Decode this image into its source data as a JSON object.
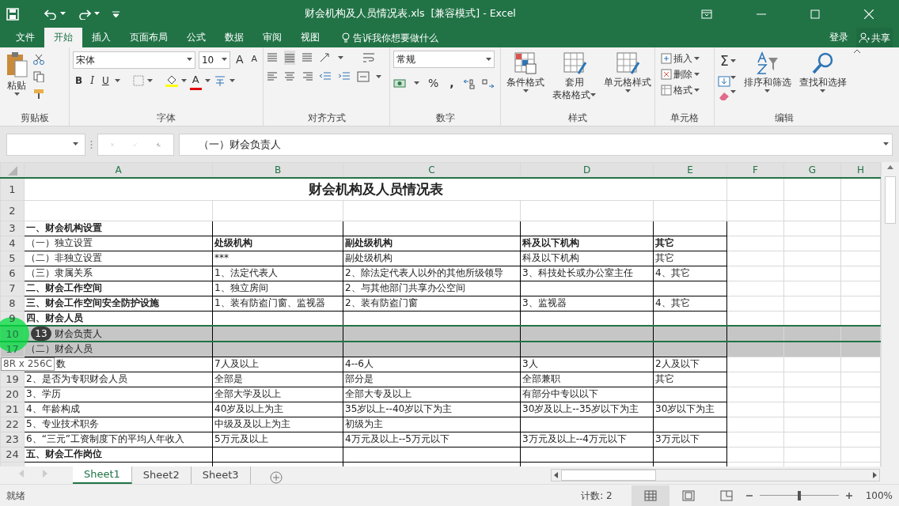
{
  "title_bar": {
    "title": "财会机构及人员情况表.xls  [兼容模式] - Excel"
  },
  "ribbon_tabs": [
    {
      "label": "文件",
      "selected": false
    },
    {
      "label": "开始",
      "selected": true
    },
    {
      "label": "插入",
      "selected": false
    },
    {
      "label": "页面布局",
      "selected": false
    },
    {
      "label": "公式",
      "selected": false
    },
    {
      "label": "数据",
      "selected": false
    },
    {
      "label": "审阅",
      "selected": false
    },
    {
      "label": "视图",
      "selected": false
    }
  ],
  "tell_me": "告诉我你想要做什么",
  "account": {
    "sign_in": "登录",
    "share": "共享"
  },
  "ribbon": {
    "clipboard": {
      "paste": "粘贴",
      "label": "剪贴板"
    },
    "font": {
      "name": "宋体",
      "size": "10",
      "grow": "A",
      "shrink": "A",
      "bold": "B",
      "italic": "I",
      "underline": "U",
      "font_color": "A",
      "label": "字体"
    },
    "alignment": {
      "label": "对齐方式"
    },
    "number": {
      "format": "常规",
      "percent": "%",
      "comma": ",",
      "label": "数字"
    },
    "styles": {
      "conditional": "条件格式",
      "table_line1": "套用",
      "table_line2": "表格格式",
      "cell_styles": "单元格样式",
      "label": "样式"
    },
    "cells": {
      "insert": "插入",
      "delete": "删除",
      "format": "格式",
      "label": "单元格"
    },
    "editing": {
      "sum": "Σ",
      "sort": "排序和筛选",
      "find": "查找和选择",
      "label": "编辑"
    }
  },
  "formula_bar": {
    "content": "（一）财会负责人"
  },
  "columns": [
    {
      "label": "A",
      "selected": true
    },
    {
      "label": "B",
      "selected": true
    },
    {
      "label": "C",
      "selected": true
    },
    {
      "label": "D",
      "selected": true
    },
    {
      "label": "E",
      "selected": true
    },
    {
      "label": "F",
      "selected": true
    },
    {
      "label": "G",
      "selected": true
    },
    {
      "label": "H",
      "selected": true
    }
  ],
  "rows": [
    {
      "number": "1",
      "kind": "title",
      "selected": false,
      "cells": [
        "财会机构及人员情况表"
      ]
    },
    {
      "number": "2",
      "kind": "blank",
      "selected": false
    },
    {
      "number": "3",
      "kind": "section",
      "selected": false,
      "cells": [
        "一、财会机构设置"
      ]
    },
    {
      "number": "4",
      "kind": "header",
      "selected": false,
      "cells": [
        "（一）独立设置",
        "处级机构",
        "副处级机构",
        "科及以下机构",
        "其它"
      ]
    },
    {
      "number": "5",
      "kind": "plain",
      "selected": false,
      "cells": [
        "（二）非独立设置",
        "***",
        "副处级机构",
        "科及以下机构",
        "其它"
      ]
    },
    {
      "number": "6",
      "kind": "plain",
      "selected": false,
      "cells": [
        "（三）隶属关系",
        "1、法定代表人",
        "2、除法定代表人以外的其他所级领导",
        "3、科技处长或办公室主任",
        "4、其它"
      ]
    },
    {
      "number": "7",
      "kind": "section",
      "selected": false,
      "cells": [
        "二、财会工作空间",
        "1、独立房间",
        "2、与其他部门共享办公空间"
      ]
    },
    {
      "number": "8",
      "kind": "section",
      "selected": false,
      "cells": [
        "三、财会工作空间安全防护设施",
        "1、装有防盗门窗、监视器",
        "2、装有防盗门窗",
        "3、监视器",
        "4、其它"
      ]
    },
    {
      "number": "9",
      "kind": "section",
      "selected": false,
      "cells": [
        "四、财会人员"
      ]
    },
    {
      "number": "10",
      "kind": "plain",
      "selected": true,
      "click_marker": "13",
      "cells": [
        "财会负责人"
      ]
    },
    {
      "number": "17",
      "kind": "plain",
      "selected": true,
      "cells": [
        "（二）财会人员"
      ]
    },
    {
      "kind": "plain",
      "selected": false,
      "tooltip": "8R x 256C",
      "cells": [
        "数",
        "7人及以上",
        "4--6人",
        "3人",
        "2人及以下"
      ]
    },
    {
      "number": "19",
      "kind": "plain",
      "selected": false,
      "cells": [
        "2、是否为专职财会人员",
        "全部是",
        "部分是",
        "全部兼职",
        "其它"
      ]
    },
    {
      "number": "20",
      "kind": "plain",
      "selected": false,
      "cells": [
        "3、学历",
        "全部大学及以上",
        "全部大专及以上",
        "有部分中专以以下",
        null
      ]
    },
    {
      "number": "21",
      "kind": "plain",
      "selected": false,
      "cells": [
        "4、年龄构成",
        "40岁及以上为主",
        "35岁以上--40岁以下为主",
        "30岁及以上--35岁以下为主",
        "30岁以下为主"
      ]
    },
    {
      "number": "22",
      "kind": "plain",
      "selected": false,
      "cells": [
        "5、专业技术职务",
        "中级及及以上为主",
        "初级为主"
      ]
    },
    {
      "number": "23",
      "kind": "plain",
      "selected": false,
      "cells": [
        "6、“三元”工资制度下的平均人年收入",
        "5万元及以上",
        "4万元及以上--5万元以下",
        "3万元及以上--4万元以下",
        "3万元以下"
      ]
    },
    {
      "number": "24",
      "kind": "section",
      "selected": false,
      "cells": [
        "五、财会工作岗位"
      ]
    }
  ],
  "sheet_tabs": [
    {
      "label": "Sheet1",
      "selected": true
    },
    {
      "label": "Sheet2",
      "selected": false
    },
    {
      "label": "Sheet3",
      "selected": false
    }
  ],
  "status_bar": {
    "mode": "就绪",
    "count": "计数: 2",
    "zoom": "100%",
    "zoom_slider": {
      "level": 0.5
    }
  }
}
